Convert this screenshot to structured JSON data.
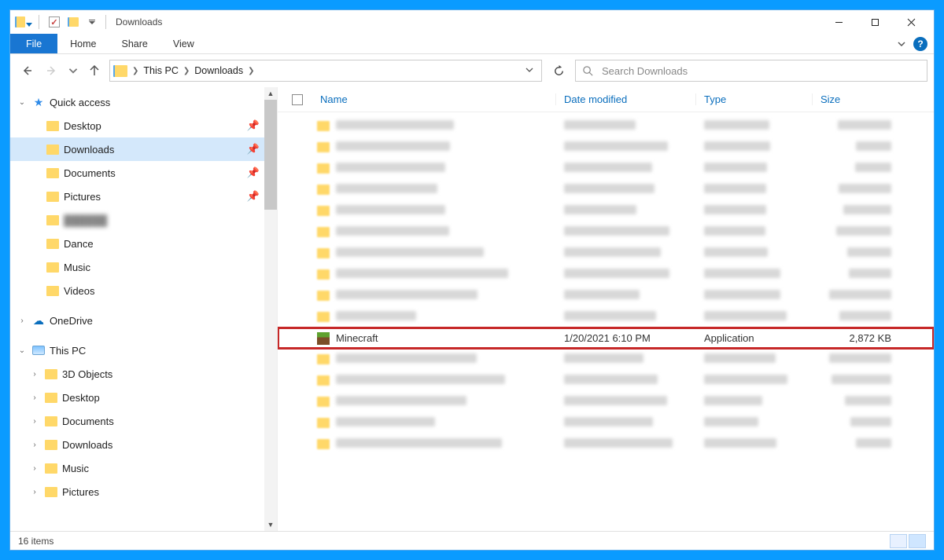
{
  "window": {
    "title": "Downloads"
  },
  "ribbon": {
    "file": "File",
    "tabs": [
      "Home",
      "Share",
      "View"
    ]
  },
  "breadcrumb": {
    "root_icon": "folder-icon",
    "items": [
      "This PC",
      "Downloads"
    ]
  },
  "search": {
    "placeholder": "Search Downloads"
  },
  "tree": {
    "quick_access": {
      "label": "Quick access",
      "expanded": true
    },
    "quick_items": [
      {
        "label": "Desktop",
        "pinned": true
      },
      {
        "label": "Downloads",
        "pinned": true,
        "selected": true
      },
      {
        "label": "Documents",
        "pinned": true
      },
      {
        "label": "Pictures",
        "pinned": true
      },
      {
        "label": "██████",
        "pinned": false,
        "blur": true
      },
      {
        "label": "Dance",
        "pinned": false
      },
      {
        "label": "Music",
        "pinned": false
      },
      {
        "label": "Videos",
        "pinned": false
      }
    ],
    "onedrive": {
      "label": "OneDrive",
      "expanded": false
    },
    "this_pc": {
      "label": "This PC",
      "expanded": true
    },
    "this_pc_items": [
      {
        "label": "3D Objects"
      },
      {
        "label": "Desktop"
      },
      {
        "label": "Documents"
      },
      {
        "label": "Downloads"
      },
      {
        "label": "Music"
      },
      {
        "label": "Pictures"
      }
    ]
  },
  "columns": {
    "name": "Name",
    "date": "Date modified",
    "type": "Type",
    "size": "Size"
  },
  "files": {
    "highlighted": {
      "name": "Minecraft",
      "date": "1/20/2021 6:10 PM",
      "type": "Application",
      "size": "2,872 KB"
    },
    "blurred_before": 10,
    "blurred_after": 5
  },
  "status": {
    "count": "16 items"
  }
}
